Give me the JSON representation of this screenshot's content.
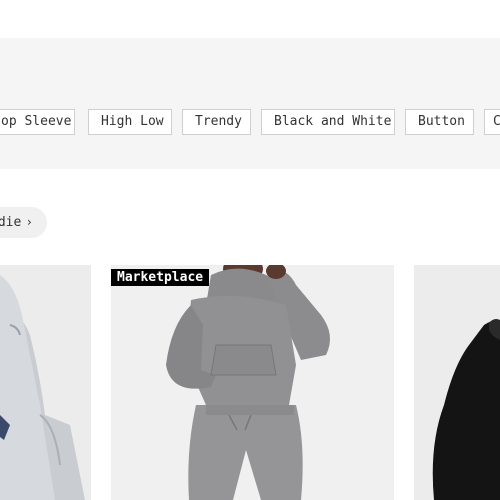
{
  "filters": {
    "chips": [
      "op Sleeve",
      "High Low",
      "Trendy",
      "Black and White",
      "Button",
      "C"
    ]
  },
  "breadcrumb": {
    "label": "odie",
    "chevron": "chevron-right-icon"
  },
  "products": [
    {
      "image": "light-gray-hoodie-photo"
    },
    {
      "badge": "Marketplace",
      "image": "gray-hoodie-tracksuit-photo"
    },
    {
      "image": "black-hoodie-photo"
    }
  ]
}
